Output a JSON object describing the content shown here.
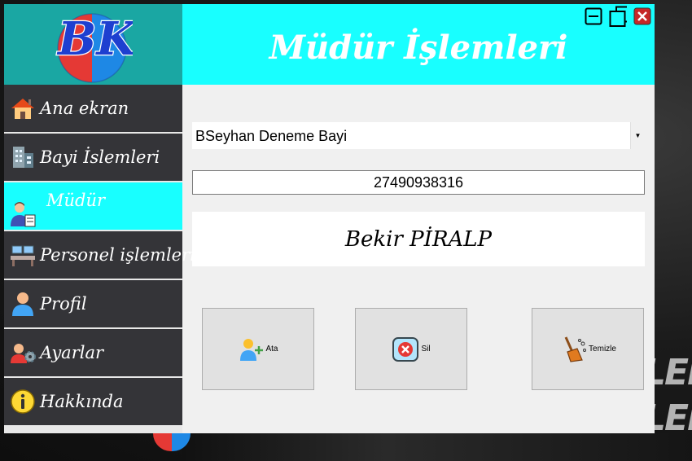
{
  "window": {
    "title": "Müdür İşlemleri",
    "logo_text": "BK"
  },
  "sidebar": {
    "items": [
      {
        "label": "Ana ekran",
        "icon": "home-icon"
      },
      {
        "label": "Bayi İslemleri",
        "icon": "building-icon"
      },
      {
        "label": "Müdür",
        "icon": "manager-icon",
        "active": true
      },
      {
        "label": "Personel işlemleri",
        "icon": "office-desk-icon"
      },
      {
        "label": "Profil",
        "icon": "user-icon"
      },
      {
        "label": "Ayarlar",
        "icon": "user-settings-icon"
      },
      {
        "label": "Hakkında",
        "icon": "info-icon"
      }
    ]
  },
  "main": {
    "dealer_select": {
      "value": "BSeyhan Deneme Bayi"
    },
    "id_field": {
      "value": "27490938316"
    },
    "manager_name": "Bekir PİRALP",
    "buttons": {
      "assign": "Ata",
      "delete": "Sil",
      "clear": "Temizle"
    }
  },
  "colors": {
    "header": "#18ffff",
    "sidebar_item": "#343438",
    "sidebar_active": "#18ffff",
    "content_bg": "#f0f0f0"
  }
}
